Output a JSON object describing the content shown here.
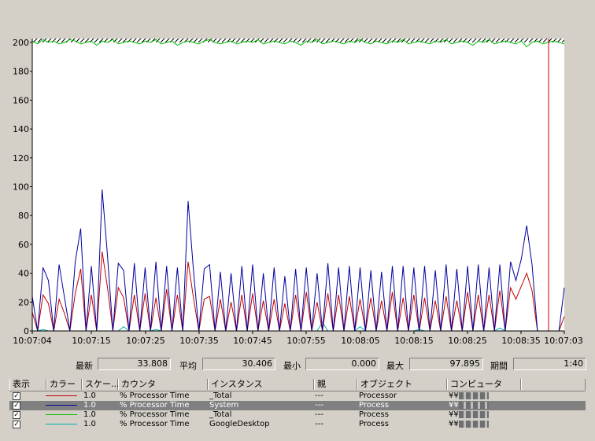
{
  "chart_data": {
    "type": "line",
    "ylim": [
      0,
      200
    ],
    "y_ticks": [
      "200",
      "180",
      "160",
      "140",
      "120",
      "100",
      "80",
      "60",
      "40",
      "20",
      "0"
    ],
    "x_ticks": [
      "10:07:04",
      "10:07:15",
      "10:07:25",
      "10:07:35",
      "10:07:45",
      "10:07:55",
      "10:08:05",
      "10:08:15",
      "10:08:25",
      "10:08:35",
      "10:07:03"
    ],
    "grid": false,
    "samples": 100,
    "series": [
      {
        "name": "_Total",
        "color": "#c00000",
        "values": [
          13,
          0,
          25,
          19,
          0,
          22,
          12,
          0,
          26,
          43,
          0,
          25,
          0,
          55,
          30,
          0,
          30,
          23,
          0,
          25,
          0,
          26,
          0,
          23,
          0,
          29,
          0,
          25,
          0,
          48,
          23,
          0,
          22,
          24,
          0,
          22,
          0,
          20,
          0,
          25,
          0,
          26,
          0,
          21,
          0,
          22,
          0,
          19,
          0,
          25,
          0,
          27,
          0,
          20,
          0,
          26,
          0,
          25,
          0,
          24,
          0,
          22,
          0,
          23,
          0,
          21,
          0,
          27,
          0,
          23,
          0,
          25,
          0,
          23,
          0,
          21,
          0,
          24,
          0,
          21,
          0,
          27,
          0,
          25,
          0,
          25,
          0,
          28,
          0,
          30,
          22,
          31,
          40,
          28,
          0,
          0,
          0,
          0,
          0,
          10
        ]
      },
      {
        "name": "System",
        "color": "#0000a0",
        "values": [
          24,
          0,
          44,
          35,
          0,
          46,
          23,
          0,
          48,
          71,
          0,
          45,
          0,
          98,
          52,
          0,
          47,
          42,
          0,
          47,
          0,
          44,
          0,
          48,
          0,
          45,
          0,
          44,
          0,
          90,
          42,
          0,
          43,
          46,
          0,
          41,
          0,
          40,
          0,
          45,
          0,
          46,
          0,
          40,
          0,
          44,
          0,
          38,
          0,
          43,
          0,
          44,
          0,
          40,
          0,
          47,
          0,
          44,
          0,
          45,
          0,
          44,
          0,
          42,
          0,
          41,
          0,
          45,
          0,
          45,
          0,
          44,
          0,
          45,
          0,
          42,
          0,
          46,
          0,
          43,
          0,
          45,
          0,
          46,
          0,
          44,
          0,
          46,
          0,
          48,
          35,
          50,
          73,
          46,
          0,
          0,
          0,
          0,
          0,
          30
        ]
      },
      {
        "name": "_Total",
        "color": "#00c000",
        "values": [
          201,
          199,
          202,
          200,
          201,
          199,
          200,
          202,
          201,
          199,
          200,
          201,
          198,
          201,
          200,
          202,
          199,
          200,
          201,
          200,
          199,
          201,
          200,
          202,
          199,
          200,
          201,
          198,
          200,
          201,
          200,
          199,
          201,
          202,
          200,
          199,
          200,
          201,
          199,
          200,
          201,
          200,
          202,
          199,
          200,
          201,
          200,
          199,
          201,
          200,
          198,
          201,
          200,
          202,
          199,
          200,
          201,
          200,
          199,
          201,
          200,
          202,
          200,
          199,
          201,
          200,
          199,
          201,
          200,
          202,
          199,
          200,
          201,
          200,
          199,
          201,
          200,
          202,
          199,
          200,
          201,
          200,
          198,
          201,
          200,
          202,
          199,
          200,
          201,
          200,
          199,
          201,
          197,
          200,
          201,
          199,
          200,
          201,
          200,
          199
        ]
      },
      {
        "name": "GoogleDesktop",
        "color": "#00b0b0",
        "values": [
          0,
          0,
          1,
          0,
          0,
          0,
          0,
          0,
          0,
          0,
          0,
          0,
          0,
          0,
          0,
          0,
          0,
          3,
          0,
          0,
          0,
          0,
          0,
          1,
          0,
          0,
          0,
          0,
          0,
          0,
          0,
          0,
          0,
          0,
          0,
          0,
          0,
          0,
          0,
          0,
          0,
          0,
          0,
          0,
          0,
          0,
          0,
          0,
          0,
          0,
          0,
          0,
          0,
          0,
          6,
          0,
          0,
          0,
          0,
          0,
          0,
          3,
          0,
          0,
          0,
          0,
          0,
          0,
          0,
          0,
          0,
          0,
          1,
          0,
          0,
          0,
          0,
          0,
          0,
          0,
          0,
          0,
          0,
          0,
          0,
          0,
          0,
          2,
          0,
          0,
          0,
          0,
          0,
          0,
          0,
          0,
          0,
          0,
          0,
          0
        ]
      }
    ]
  },
  "stats": {
    "latest_label": "最新",
    "latest_value": "33.808",
    "avg_label": "平均",
    "avg_value": "30.406",
    "min_label": "最小",
    "min_value": "0.000",
    "max_label": "最大",
    "max_value": "97.895",
    "period_label": "期間",
    "period_value": "1:40"
  },
  "table": {
    "headers": [
      "表示",
      "カラー",
      "スケー...",
      "カウンタ",
      "インスタンス",
      "親",
      "オブジェクト",
      "コンピュータ"
    ],
    "rows": [
      {
        "show": "✓",
        "color": "#c00000",
        "scale": "1.0",
        "counter": "% Processor Time",
        "instance": "_Total",
        "parent": "---",
        "object": "Processor",
        "computer": "¥¥"
      },
      {
        "show": "✓",
        "color": "#0000a0",
        "scale": "1.0",
        "counter": "% Processor Time",
        "instance": "System",
        "parent": "---",
        "object": "Process",
        "computer": "¥¥"
      },
      {
        "show": "✓",
        "color": "#00c000",
        "scale": "1.0",
        "counter": "% Processor Time",
        "instance": "_Total",
        "parent": "---",
        "object": "Process",
        "computer": "¥¥"
      },
      {
        "show": "✓",
        "color": "#00b0b0",
        "scale": "1.0",
        "counter": "% Processor Time",
        "instance": "GoogleDesktop",
        "parent": "---",
        "object": "Process",
        "computer": "¥¥"
      }
    ]
  }
}
